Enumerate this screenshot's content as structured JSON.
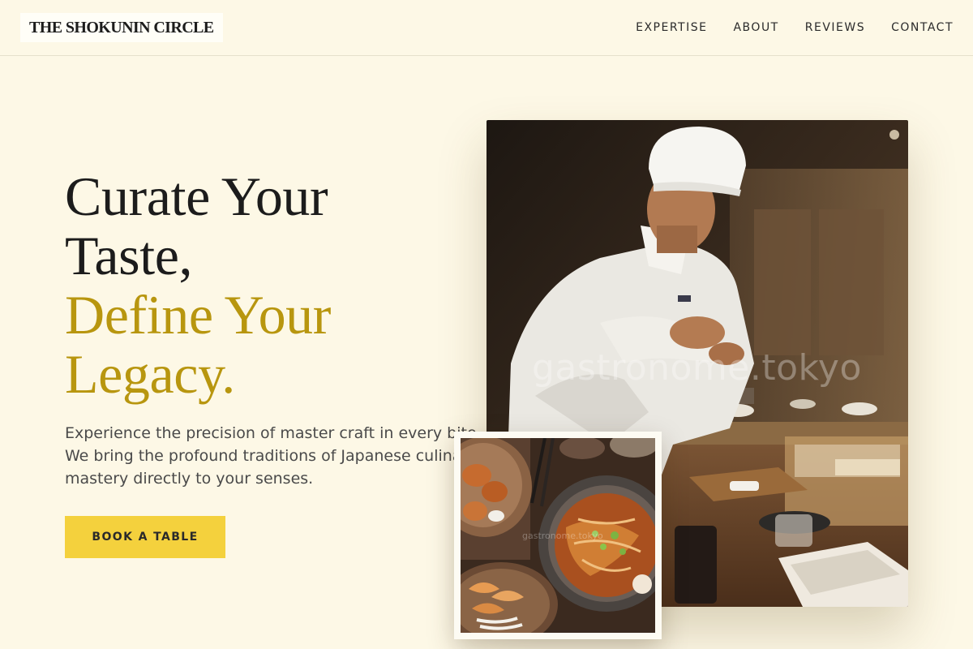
{
  "brand": {
    "name": "THE SHOKUNIN CIRCLE"
  },
  "nav": {
    "items": [
      "EXPERTISE",
      "ABOUT",
      "REVIEWS",
      "CONTACT"
    ]
  },
  "hero": {
    "headline_dark": [
      "Curate Your",
      "Taste,"
    ],
    "headline_gold": [
      "Define Your",
      "Legacy."
    ],
    "lead_lines": [
      "Experience the precision of master craft in every bite.",
      "We bring the profound traditions of Japanese culinary",
      "mastery directly to your senses."
    ],
    "cta_label": "BOOK A TABLE"
  },
  "images": {
    "chef_watermark": "gastronome.tokyo",
    "food_watermark": "gastronome.tokyo"
  },
  "colors": {
    "background": "#fdf8e6",
    "accent_gold": "#b8960f",
    "button_yellow": "#f4d13d",
    "text_dark": "#1c1c1c"
  }
}
